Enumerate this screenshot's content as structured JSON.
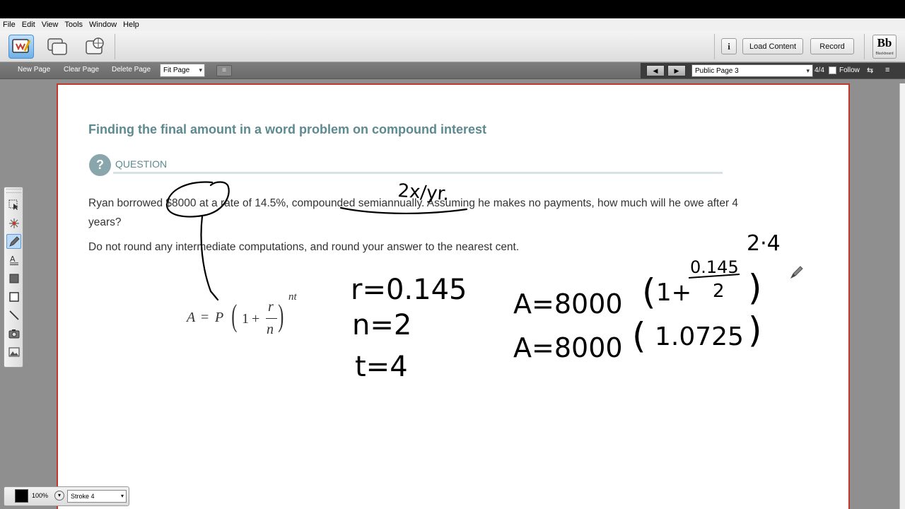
{
  "menu": [
    "File",
    "Edit",
    "View",
    "Tools",
    "Window",
    "Help"
  ],
  "toolbar": {
    "load_content": "Load Content",
    "record": "Record",
    "info_label": "i",
    "logo_text": "Bb",
    "logo_sub": "Blackboard"
  },
  "page_toolbar": {
    "new_page": "New Page",
    "clear_page": "Clear Page",
    "delete_page": "Delete Page",
    "fit_page": "Fit Page"
  },
  "navigation": {
    "page_select": "Public Page 3",
    "page_count": "4/4",
    "follow": "Follow"
  },
  "content": {
    "title": "Finding the final amount in a word problem on compound interest",
    "question_icon": "?",
    "question_label": "QUESTION",
    "problem_text": "Ryan borrowed $8000 at a rate of 14.5%, compounded semiannually. Assuming he makes no payments, how much will he owe after 4 years?",
    "instruction_text": "Do not round any intermediate computations, and round your answer to the nearest cent.",
    "formula": {
      "A": "A",
      "eq": "=",
      "P": "P",
      "one": "1",
      "plus": "+",
      "r": "r",
      "n": "n",
      "exponent": "nt"
    }
  },
  "handwriting": {
    "note_2x": "2x/yr.",
    "r_line": "r=0.145",
    "n_line": "n=2",
    "t_line": "t=4",
    "eq1_left": "A=8000",
    "eq1_num": "0.145",
    "eq1_den": "2",
    "eq1_exp": "2·4",
    "eq2": "A=8000",
    "eq2_paren": "1.0725"
  },
  "status": {
    "zoom": "100%",
    "stroke": "Stroke 4"
  },
  "colors": {
    "title": "#5d8a8f",
    "page_border": "#c0392b",
    "ink": "#000000"
  }
}
